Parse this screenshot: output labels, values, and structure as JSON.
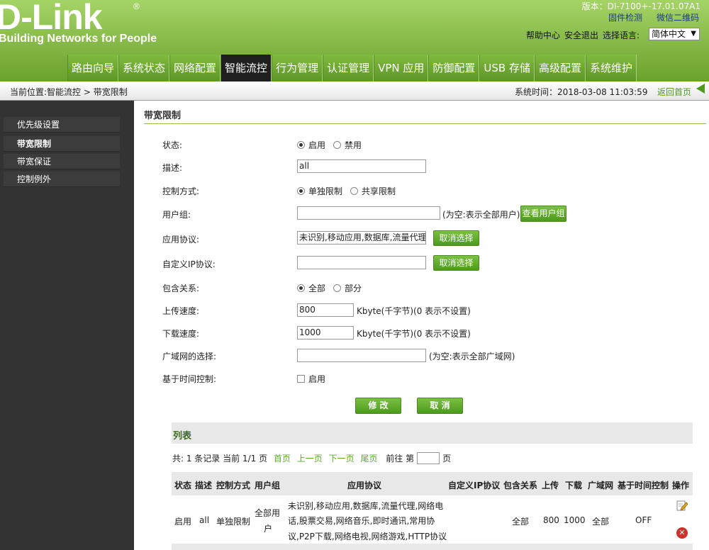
{
  "brand": {
    "logo": "D-Link",
    "registered": "®",
    "tagline": "Building Networks for People"
  },
  "top": {
    "version": "版本：DI-7100+-17.01.07A1",
    "firmware_check": "固件检测",
    "wechat_qr": "微信二维码",
    "help": "帮助中心",
    "logout": "安全退出",
    "lang_label": "选择语言:",
    "lang_value": "简体中文"
  },
  "menu": [
    {
      "label": "路由向导"
    },
    {
      "label": "系统状态"
    },
    {
      "label": "网络配置"
    },
    {
      "label": "智能流控",
      "active": true
    },
    {
      "label": "行为管理"
    },
    {
      "label": "认证管理"
    },
    {
      "label": "VPN 应用"
    },
    {
      "label": "防御配置"
    },
    {
      "label": "USB 存储"
    },
    {
      "label": "高级配置"
    },
    {
      "label": "系统维护"
    }
  ],
  "breadcrumb": "当前位置:智能流控 > 带宽限制",
  "system_time": "系统时间：2018-03-08 11:03:59",
  "back_home": "返回首页",
  "sidebar": [
    {
      "label": "优先级设置"
    },
    {
      "label": "带宽限制",
      "active": true
    },
    {
      "label": "带宽保证"
    },
    {
      "label": "控制例外"
    }
  ],
  "section_title": "带宽限制",
  "form": {
    "status": {
      "label": "状态:",
      "opt1": "启用",
      "opt2": "禁用"
    },
    "desc": {
      "label": "描述:",
      "value": "all"
    },
    "control_mode": {
      "label": "控制方式:",
      "opt1": "单独限制",
      "opt2": "共享限制"
    },
    "user_group": {
      "label": "用户组:",
      "value": "",
      "hint": "(为空:表示全部用户)",
      "button": "查看用户组"
    },
    "app_protocol": {
      "label": "应用协议:",
      "value": "未识别,移动应用,数据库,流量代理,网络电话,股票交易,网络音乐,即时通讯,常用协议,P2P下载,网络电视,网络游戏,HTTP协议",
      "button": "取消选择"
    },
    "custom_ip": {
      "label": "自定义IP协议:",
      "value": "",
      "button": "取消选择"
    },
    "include": {
      "label": "包含关系:",
      "opt1": "全部",
      "opt2": "部分"
    },
    "upload": {
      "label": "上传速度:",
      "value": "800",
      "unit": "Kbyte(千字节)(0 表示不设置)"
    },
    "download": {
      "label": "下载速度:",
      "value": "1000",
      "unit": "Kbyte(千字节)(0 表示不设置)"
    },
    "wan": {
      "label": "广域网的选择:",
      "value": "",
      "hint": "(为空:表示全部广域网)"
    },
    "time_ctrl": {
      "label": "基于时间控制:",
      "opt": "启用"
    },
    "modify_button": "修 改",
    "cancel_button": "取 消"
  },
  "list": {
    "title": "列表",
    "pager": {
      "summary": "共: 1 条记录  当前 1/1 页",
      "first": "首页",
      "prev": "上一页",
      "next": "下一页",
      "last": "尾页",
      "goto": "前往 第",
      "page_unit": "页"
    },
    "columns": [
      "状态",
      "描述",
      "控制方式",
      "用户组",
      "应用协议",
      "自定义IP协议",
      "包含关系",
      "上传",
      "下载",
      "广域网",
      "基于时间控制",
      "操作"
    ],
    "rows": [
      {
        "status": "启用",
        "desc": "all",
        "mode": "单独限制",
        "group_line1": "全部用",
        "group_line2": "户",
        "proto_line1": "未识别,移动应用,数据库,流量代理,网络电",
        "proto_line2": "话,股票交易,网络音乐,即时通讯,常用协",
        "proto_line3": "议,P2P下载,网络电视,网络游戏,HTTP协议",
        "custom_ip": "",
        "include": "全部",
        "up": "800",
        "down": "1000",
        "wan": "全部",
        "time": "OFF"
      }
    ]
  }
}
